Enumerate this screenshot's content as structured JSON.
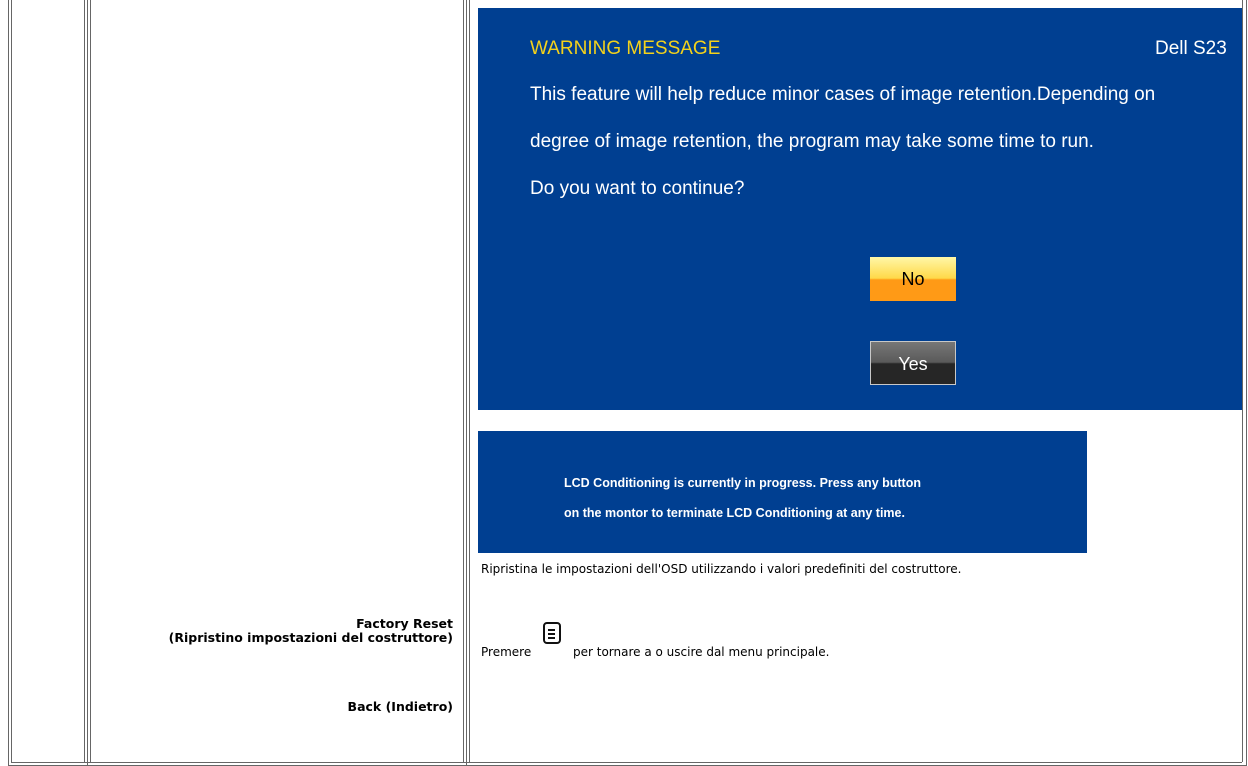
{
  "rows": [
    {
      "title_line1": "Factory Reset",
      "title_line2": "(Ripristino impostazioni del costruttore)",
      "description": "Ripristina le impostazioni dell'OSD utilizzando i valori predefiniti del costruttore."
    },
    {
      "title": "Back (Indietro)",
      "description_before": "Premere",
      "icon": "menu-icon",
      "description_after": "per tornare a o uscire dal menu principale."
    }
  ],
  "warning_dialog": {
    "title": "WARNING MESSAGE",
    "brand": "Dell S23",
    "lines": [
      "This feature will help reduce minor cases of image retention.Depending on",
      "degree of image retention, the program may take some time to run.",
      "Do you want to continue?"
    ],
    "no_label": "No",
    "yes_label": "Yes",
    "colors": {
      "background": "#003f91",
      "title": "#f3d21b",
      "no_button": "#ffb020",
      "yes_button": "#2e2e2e"
    }
  },
  "progress_panel": {
    "lines": [
      "LCD Conditioning is currently in progress. Press any button",
      "on the montor to terminate LCD Conditioning at any time."
    ]
  }
}
